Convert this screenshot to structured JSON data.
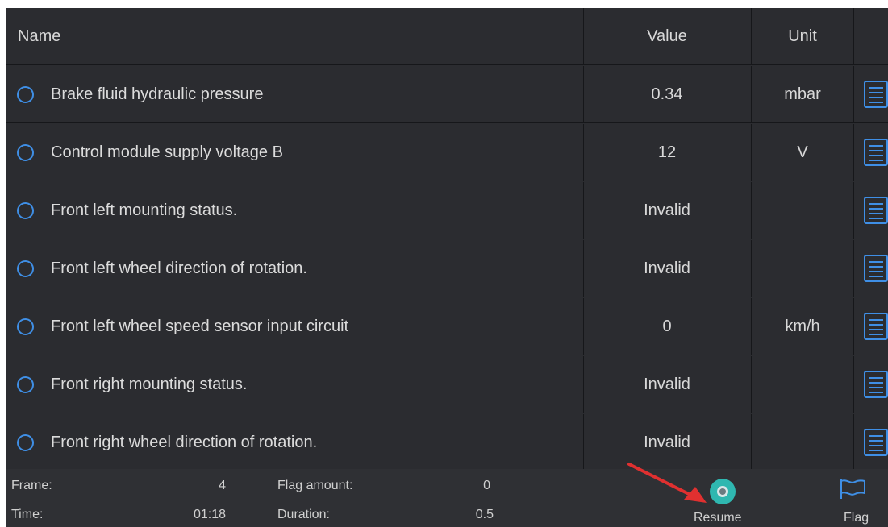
{
  "table": {
    "headers": {
      "name": "Name",
      "value": "Value",
      "unit": "Unit"
    },
    "rows": [
      {
        "name": "Brake fluid hydraulic pressure",
        "value": "0.34",
        "unit": "mbar"
      },
      {
        "name": "Control module supply voltage B",
        "value": "12",
        "unit": "V"
      },
      {
        "name": "Front left mounting status.",
        "value": "Invalid",
        "unit": ""
      },
      {
        "name": "Front left wheel direction of rotation.",
        "value": "Invalid",
        "unit": ""
      },
      {
        "name": "Front left wheel speed sensor input circuit",
        "value": "0",
        "unit": "km/h"
      },
      {
        "name": "Front right mounting status.",
        "value": "Invalid",
        "unit": ""
      },
      {
        "name": "Front right wheel direction of rotation.",
        "value": "Invalid",
        "unit": ""
      }
    ]
  },
  "footer": {
    "frame_label": "Frame:",
    "frame_value": "4",
    "flag_amount_label": "Flag amount:",
    "flag_amount_value": "0",
    "time_label": "Time:",
    "time_value": "01:18",
    "duration_label": "Duration:",
    "duration_value": "0.5",
    "resume_label": "Resume",
    "flag_label": "Flag"
  },
  "icons": {
    "row_select": "radio-circle-icon",
    "row_detail": "list-detail-icon",
    "resume": "resume-record-icon",
    "flag": "flag-icon",
    "annotation": "red-arrow-icon"
  },
  "colors": {
    "background": "#2b2c30",
    "accent": "#3f8fe6",
    "resume_button": "#2fb7b0",
    "annotation": "#e03030"
  }
}
